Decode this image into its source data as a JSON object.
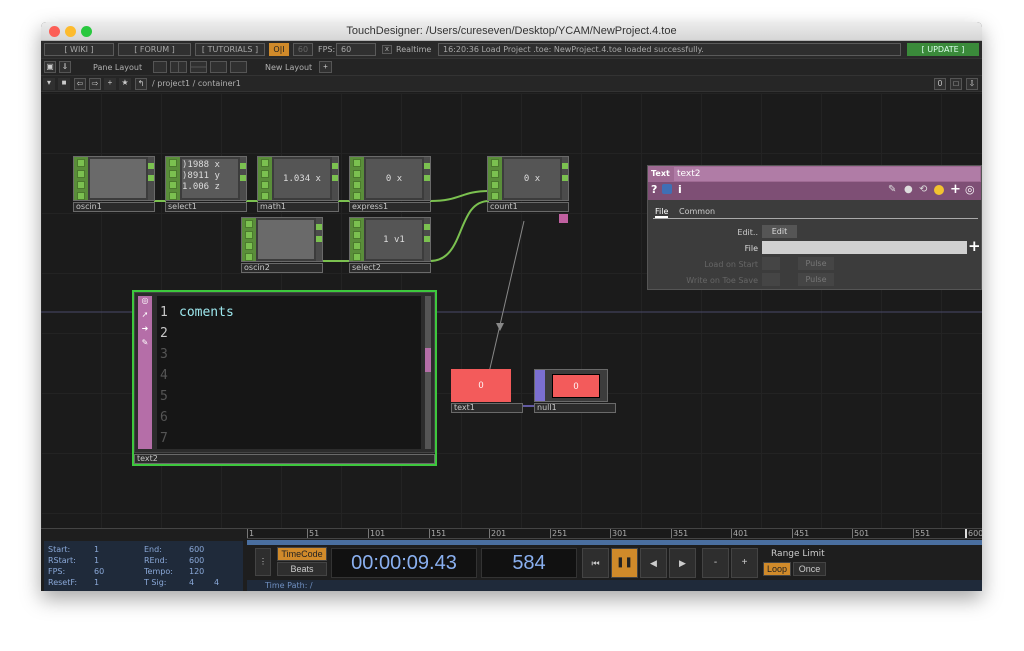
{
  "window": {
    "title": "TouchDesigner: /Users/cureseven/Desktop/YCAM/NewProject.4.toe"
  },
  "menubar": {
    "wiki": "[ WIKI ]",
    "forum": "[ FORUM ]",
    "tutorials": "[ TUTORIALS ]",
    "oi": "O|I",
    "sixty": "60",
    "fps_label": "FPS:",
    "fps_value": "60",
    "realtime": "Realtime",
    "status": "16:20:36 Load Project .toe: NewProject.4.toe loaded successfully.",
    "update": "[ UPDATE ]"
  },
  "panebar": {
    "pane_layout": "Pane Layout",
    "new_layout": "New Layout",
    "plus": "+"
  },
  "pathbar": {
    "path": "/ project1 / container1",
    "zero": "0"
  },
  "nodes": {
    "oscin1": "oscin1",
    "select1": "select1",
    "math1": "math1",
    "express1": "express1",
    "count1": "count1",
    "oscin2": "oscin2",
    "select2": "select2",
    "text1": "text1",
    "null1": "null1",
    "text2": "text2"
  },
  "node_values": {
    "select1_l1": ")1988 x",
    "select1_l2": ")8911 y",
    "select1_l3": "1.006 z",
    "math1": "1.034 x",
    "express1": "0 x",
    "count1": "0 x",
    "select2": "1 v1",
    "text1": "0",
    "null1": "0"
  },
  "text_dat": {
    "lines": [
      "1",
      "2",
      "3",
      "4",
      "5",
      "6",
      "7"
    ],
    "content": "coments"
  },
  "params": {
    "op_type": "Text",
    "op_name": "text2",
    "tab_file": "File",
    "tab_common": "Common",
    "edit_label": "Edit..",
    "edit_button": "Edit",
    "file_label": "File",
    "load_on_start": "Load on Start",
    "write_on_toe_save": "Write on Toe Save",
    "pulse1": "Pulse",
    "pulse2": "Pulse",
    "help": "?",
    "info": "i"
  },
  "timeline": {
    "ruler": [
      "1",
      "51",
      "101",
      "151",
      "201",
      "251",
      "301",
      "351",
      "401",
      "451",
      "501",
      "551",
      "600"
    ],
    "start_label": "Start:",
    "start": "1",
    "rstart_label": "RStart:",
    "rstart": "1",
    "fps_label": "FPS:",
    "fps": "60",
    "resetf_label": "ResetF:",
    "resetf": "1",
    "end_label": "End:",
    "end": "600",
    "rend_label": "REnd:",
    "rend": "600",
    "tempo_label": "Tempo:",
    "tempo": "120",
    "tsig_label": "T Sig:",
    "tsig_a": "4",
    "tsig_b": "4",
    "timecode": "TimeCode",
    "beats": "Beats",
    "time": "00:00:09.43",
    "frame": "584",
    "range_limit": "Range Limit",
    "loop": "Loop",
    "once": "Once",
    "time_path": "Time Path: /",
    "minus": "-",
    "plus": "+"
  }
}
